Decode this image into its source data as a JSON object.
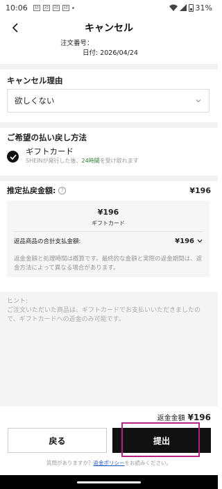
{
  "status_bar": {
    "time": "10:06",
    "notifications": [
      "ﾇｶ",
      "ﾇｶ",
      "ﾇｶ",
      "ﾇｶ"
    ],
    "battery": "31%"
  },
  "header": {
    "title": "キャンセル"
  },
  "order": {
    "number_label": "注文番号：",
    "date_label": "日付: 2026/04/24"
  },
  "cancel_reason": {
    "title": "キャンセル理由",
    "selected": "欲しくない"
  },
  "refund_method": {
    "title": "ご希望の払い戻し方法",
    "option_name": "ギフトカード",
    "desc_prefix": "SHEINが発行した後、",
    "desc_highlight": "24時間",
    "desc_suffix": "を受け取れます"
  },
  "estimated_refund": {
    "label": "推定払戻金額:",
    "amount": "¥196",
    "box_amount": "¥196",
    "box_via": "ギフトカード",
    "total_label": "返品商品の合計支払金額:",
    "total_value": "¥196",
    "note": "返金金額と処理時間は概算です。最終的な金額と実際の返金期間は、返金方法によって異なる場合があります。"
  },
  "hint": {
    "label": "ヒント:",
    "text": "ご注文いただいた商品は、ギフトカードでお支払いいただきましたので、ギフトカードへの返金のみ可能です。"
  },
  "footer": {
    "refund_label": "返金金額",
    "refund_value": "¥196",
    "return_button": "戻る",
    "submit_button": "提出",
    "policy_prefix": "質問がありますか？",
    "policy_link": "返金ポリシー",
    "policy_suffix": "をお読みください。"
  },
  "colors": {
    "highlight_green": "#2e7d32",
    "link_blue": "#2458c4",
    "annotation_border": "#b0237e"
  }
}
